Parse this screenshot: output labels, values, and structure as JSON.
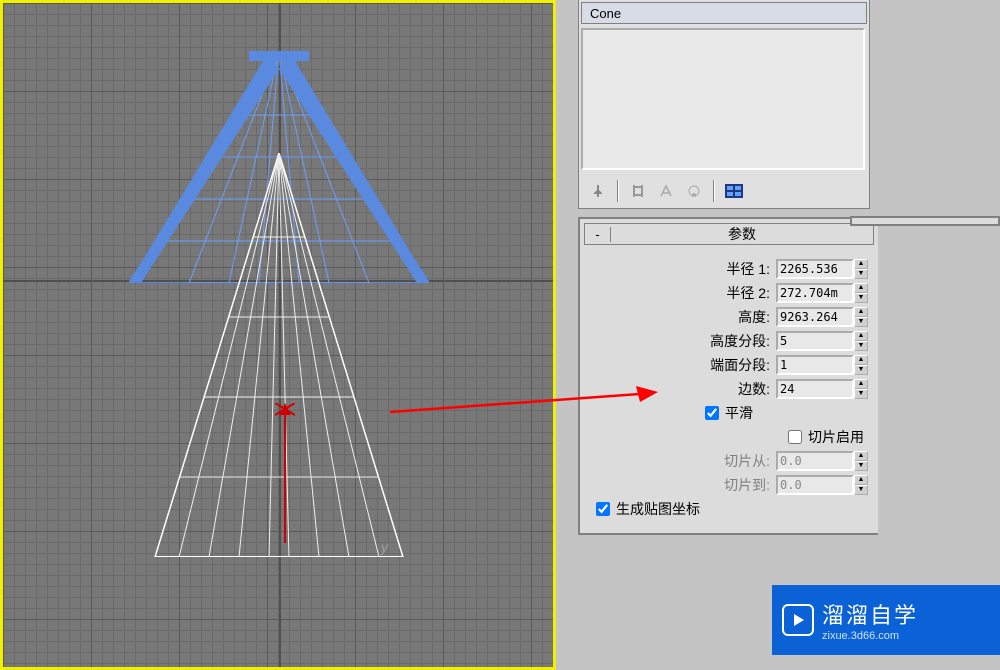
{
  "viewport": {
    "axis_y": "y"
  },
  "modifier_stack": {
    "object_name": "Cone"
  },
  "params": {
    "title": "参数",
    "rows": [
      {
        "label": "半径 1:",
        "value": "2265.536"
      },
      {
        "label": "半径 2:",
        "value": "272.704m"
      },
      {
        "label": "高度:",
        "value": "9263.264"
      },
      {
        "label": "高度分段:",
        "value": "5"
      },
      {
        "label": "端面分段:",
        "value": "1"
      },
      {
        "label": "边数:",
        "value": "24"
      }
    ],
    "smooth_label": "平滑",
    "slice_on_label": "切片启用",
    "slice_from_label": "切片从:",
    "slice_from_value": "0.0",
    "slice_to_label": "切片到:",
    "slice_to_value": "0.0",
    "gen_mapping_label": "生成贴图坐标",
    "smooth_checked": true,
    "slice_checked": false,
    "gen_mapping_checked": true
  },
  "watermark": {
    "title": "溜溜自学",
    "url": "zixue.3d66.com"
  }
}
